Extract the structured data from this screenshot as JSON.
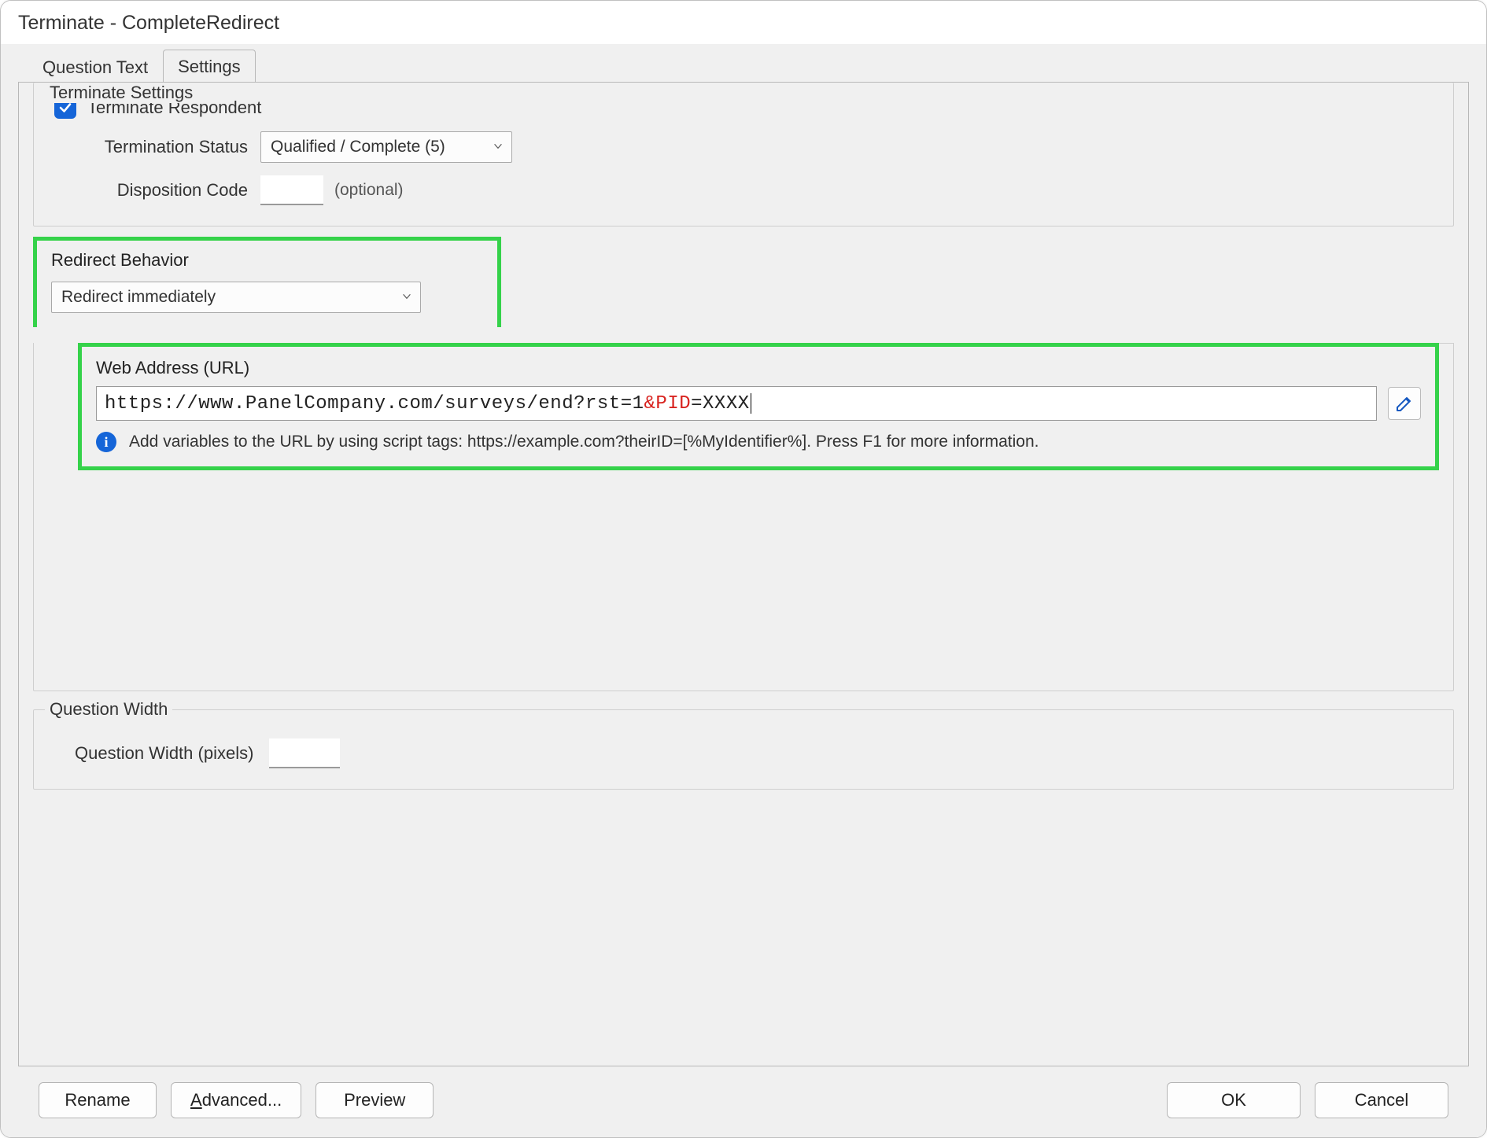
{
  "window": {
    "title": "Terminate - CompleteRedirect"
  },
  "tabs": {
    "question_text": "Question Text",
    "settings": "Settings",
    "active": "settings"
  },
  "terminate": {
    "legend": "Terminate Settings",
    "checkbox_label": "Terminate Respondent",
    "checked": true,
    "status_label": "Termination Status",
    "status_value": "Qualified / Complete (5)",
    "disposition_label": "Disposition Code",
    "disposition_value": "",
    "optional": "(optional)"
  },
  "redirect": {
    "legend": "Redirect Behavior",
    "mode_value": "Redirect immediately",
    "url_label": "Web Address (URL)",
    "url_parts": {
      "p1": "https://www.PanelCompany.com/surveys/end?rst=1",
      "p2": "&PID",
      "p3": "=XXXX"
    },
    "hint": "Add variables to the URL by using script tags: https://example.com?theirID=[%MyIdentifier%]. Press F1 for more information."
  },
  "question_width": {
    "legend": "Question Width",
    "label": "Question Width (pixels)",
    "value": ""
  },
  "buttons": {
    "rename": "Rename",
    "advanced_prefix": "A",
    "advanced_rest": "dvanced...",
    "preview": "Preview",
    "ok": "OK",
    "cancel": "Cancel"
  }
}
